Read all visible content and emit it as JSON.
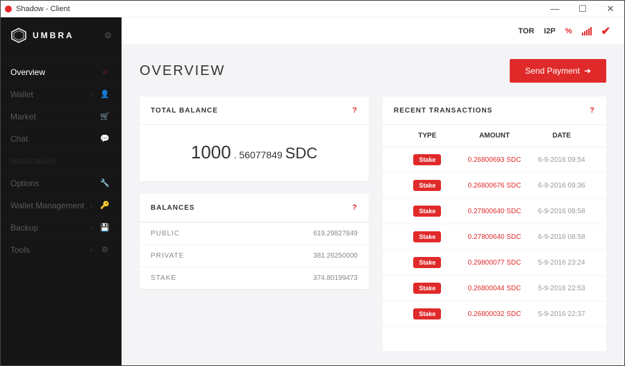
{
  "window": {
    "title": "Shadow - Client"
  },
  "brand": {
    "name": "UMBRA"
  },
  "sidebar": {
    "items": [
      {
        "label": "Overview",
        "icon": "circle",
        "active": true,
        "expandable": false
      },
      {
        "label": "Wallet",
        "icon": "user",
        "active": false,
        "expandable": true
      },
      {
        "label": "Market",
        "icon": "cart",
        "active": false,
        "expandable": false
      },
      {
        "label": "Chat",
        "icon": "chat",
        "active": false,
        "expandable": false
      },
      {
        "label": "Notifications",
        "icon": "",
        "active": false,
        "expandable": false
      },
      {
        "label": "Options",
        "icon": "wrench",
        "active": false,
        "expandable": false
      },
      {
        "label": "Wallet Management",
        "icon": "key",
        "active": false,
        "expandable": true
      },
      {
        "label": "Backup",
        "icon": "save",
        "active": false,
        "expandable": true
      },
      {
        "label": "Tools",
        "icon": "sliders",
        "active": false,
        "expandable": true
      }
    ]
  },
  "topbar": {
    "tor": "TOR",
    "i2p": "I2P",
    "percent": "%"
  },
  "header": {
    "title": "OVERVIEW",
    "send_label": "Send Payment"
  },
  "total_balance": {
    "title": "TOTAL BALANCE",
    "int": "1000",
    "frac": "56077849",
    "currency": "SDC"
  },
  "balances": {
    "title": "BALANCES",
    "rows": [
      {
        "label": "PUBLIC",
        "value": "619.29827849"
      },
      {
        "label": "PRIVATE",
        "value": "381.26250000"
      },
      {
        "label": "STAKE",
        "value": "374.80199473"
      }
    ]
  },
  "transactions": {
    "title": "RECENT TRANSACTIONS",
    "col_type": "TYPE",
    "col_amount": "AMOUNT",
    "col_date": "DATE",
    "rows": [
      {
        "type": "Stake",
        "amount": "0.26800693 SDC",
        "date": "6-9-2016 09:54"
      },
      {
        "type": "Stake",
        "amount": "0.26800676 SDC",
        "date": "6-9-2016 09:36"
      },
      {
        "type": "Stake",
        "amount": "0.27800640 SDC",
        "date": "6-9-2016 08:58"
      },
      {
        "type": "Stake",
        "amount": "0.27800640 SDC",
        "date": "6-9-2016 08:58"
      },
      {
        "type": "Stake",
        "amount": "0.29800077 SDC",
        "date": "5-9-2016 23:24"
      },
      {
        "type": "Stake",
        "amount": "0.26800044 SDC",
        "date": "5-9-2016 22:53"
      },
      {
        "type": "Stake",
        "amount": "0.26800032 SDC",
        "date": "5-9-2016 22:37"
      }
    ]
  }
}
